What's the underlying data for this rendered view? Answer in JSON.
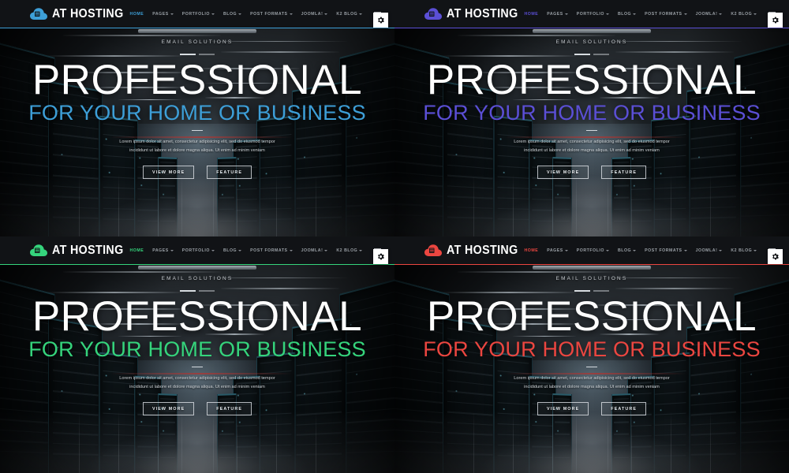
{
  "panels": [
    {
      "id": "panel-blue",
      "accent": "#3d9fd8",
      "accent_name": "blue",
      "brand": {
        "name": "AT HOSTING",
        "logo_icon": "cloud-server-icon"
      },
      "nav": {
        "items": [
          {
            "label": "HOME",
            "active": true,
            "caret": false
          },
          {
            "label": "PAGES",
            "active": false,
            "caret": true
          },
          {
            "label": "PORTFOLIO",
            "active": false,
            "caret": true
          },
          {
            "label": "BLOG",
            "active": false,
            "caret": true
          },
          {
            "label": "POST FORMATS",
            "active": false,
            "caret": true
          },
          {
            "label": "JOOMLA!",
            "active": false,
            "caret": true
          },
          {
            "label": "K2 BLOG",
            "active": false,
            "caret": true
          }
        ],
        "menu_icon": "hamburger-icon"
      },
      "hero": {
        "kicker": "EMAIL SOLUTIONS",
        "title": "PROFESSIONAL",
        "subtitle": "FOR YOUR HOME OR BUSINESS",
        "description": "Lorem ipsum dolor sit amet, consectetur adipisicing elit, sed do eiusmod tempor incididunt ut labore et dolore magna aliqua. Ut enim ad minim veniam",
        "primary_button": "VIEW MORE",
        "secondary_button": "FEATURE"
      },
      "settings": {
        "icon": "gear-icon"
      }
    },
    {
      "id": "panel-purple",
      "accent": "#5b4fd6",
      "accent_name": "purple",
      "brand": {
        "name": "AT HOSTING",
        "logo_icon": "cloud-server-icon"
      },
      "nav": {
        "items": [
          {
            "label": "HOME",
            "active": true,
            "caret": false
          },
          {
            "label": "PAGES",
            "active": false,
            "caret": true
          },
          {
            "label": "PORTFOLIO",
            "active": false,
            "caret": true
          },
          {
            "label": "BLOG",
            "active": false,
            "caret": true
          },
          {
            "label": "POST FORMATS",
            "active": false,
            "caret": true
          },
          {
            "label": "JOOMLA!",
            "active": false,
            "caret": true
          },
          {
            "label": "K2 BLOG",
            "active": false,
            "caret": true
          }
        ],
        "menu_icon": "hamburger-icon"
      },
      "hero": {
        "kicker": "EMAIL SOLUTIONS",
        "title": "PROFESSIONAL",
        "subtitle": "FOR YOUR HOME OR BUSINESS",
        "description": "Lorem ipsum dolor sit amet, consectetur adipisicing elit, sed do eiusmod tempor incididunt ut labore et dolore magna aliqua. Ut enim ad minim veniam",
        "primary_button": "VIEW MORE",
        "secondary_button": "FEATURE"
      },
      "settings": {
        "icon": "gear-icon"
      }
    },
    {
      "id": "panel-green",
      "accent": "#35d47c",
      "accent_name": "green",
      "brand": {
        "name": "AT HOSTING",
        "logo_icon": "cloud-server-icon"
      },
      "nav": {
        "items": [
          {
            "label": "HOME",
            "active": true,
            "caret": false
          },
          {
            "label": "PAGES",
            "active": false,
            "caret": true
          },
          {
            "label": "PORTFOLIO",
            "active": false,
            "caret": true
          },
          {
            "label": "BLOG",
            "active": false,
            "caret": true
          },
          {
            "label": "POST FORMATS",
            "active": false,
            "caret": true
          },
          {
            "label": "JOOMLA!",
            "active": false,
            "caret": true
          },
          {
            "label": "K2 BLOG",
            "active": false,
            "caret": true
          }
        ],
        "menu_icon": "hamburger-icon"
      },
      "hero": {
        "kicker": "EMAIL SOLUTIONS",
        "title": "PROFESSIONAL",
        "subtitle": "FOR YOUR HOME OR BUSINESS",
        "description": "Lorem ipsum dolor sit amet, consectetur adipisicing elit, sed do eiusmod tempor incididunt ut labore et dolore magna aliqua. Ut enim ad minim veniam",
        "primary_button": "VIEW MORE",
        "secondary_button": "FEATURE"
      },
      "settings": {
        "icon": "gear-icon"
      }
    },
    {
      "id": "panel-red",
      "accent": "#ec4640",
      "accent_name": "red",
      "brand": {
        "name": "AT HOSTING",
        "logo_icon": "cloud-server-icon"
      },
      "nav": {
        "items": [
          {
            "label": "HOME",
            "active": true,
            "caret": false
          },
          {
            "label": "PAGES",
            "active": false,
            "caret": true
          },
          {
            "label": "PORTFOLIO",
            "active": false,
            "caret": true
          },
          {
            "label": "BLOG",
            "active": false,
            "caret": true
          },
          {
            "label": "POST FORMATS",
            "active": false,
            "caret": true
          },
          {
            "label": "JOOMLA!",
            "active": false,
            "caret": true
          },
          {
            "label": "K2 BLOG",
            "active": false,
            "caret": true
          }
        ],
        "menu_icon": "hamburger-icon"
      },
      "hero": {
        "kicker": "EMAIL SOLUTIONS",
        "title": "PROFESSIONAL",
        "subtitle": "FOR YOUR HOME OR BUSINESS",
        "description": "Lorem ipsum dolor sit amet, consectetur adipisicing elit, sed do eiusmod tempor incididunt ut labore et dolore magna aliqua. Ut enim ad minim veniam",
        "primary_button": "VIEW MORE",
        "secondary_button": "FEATURE"
      },
      "settings": {
        "icon": "gear-icon"
      }
    }
  ]
}
